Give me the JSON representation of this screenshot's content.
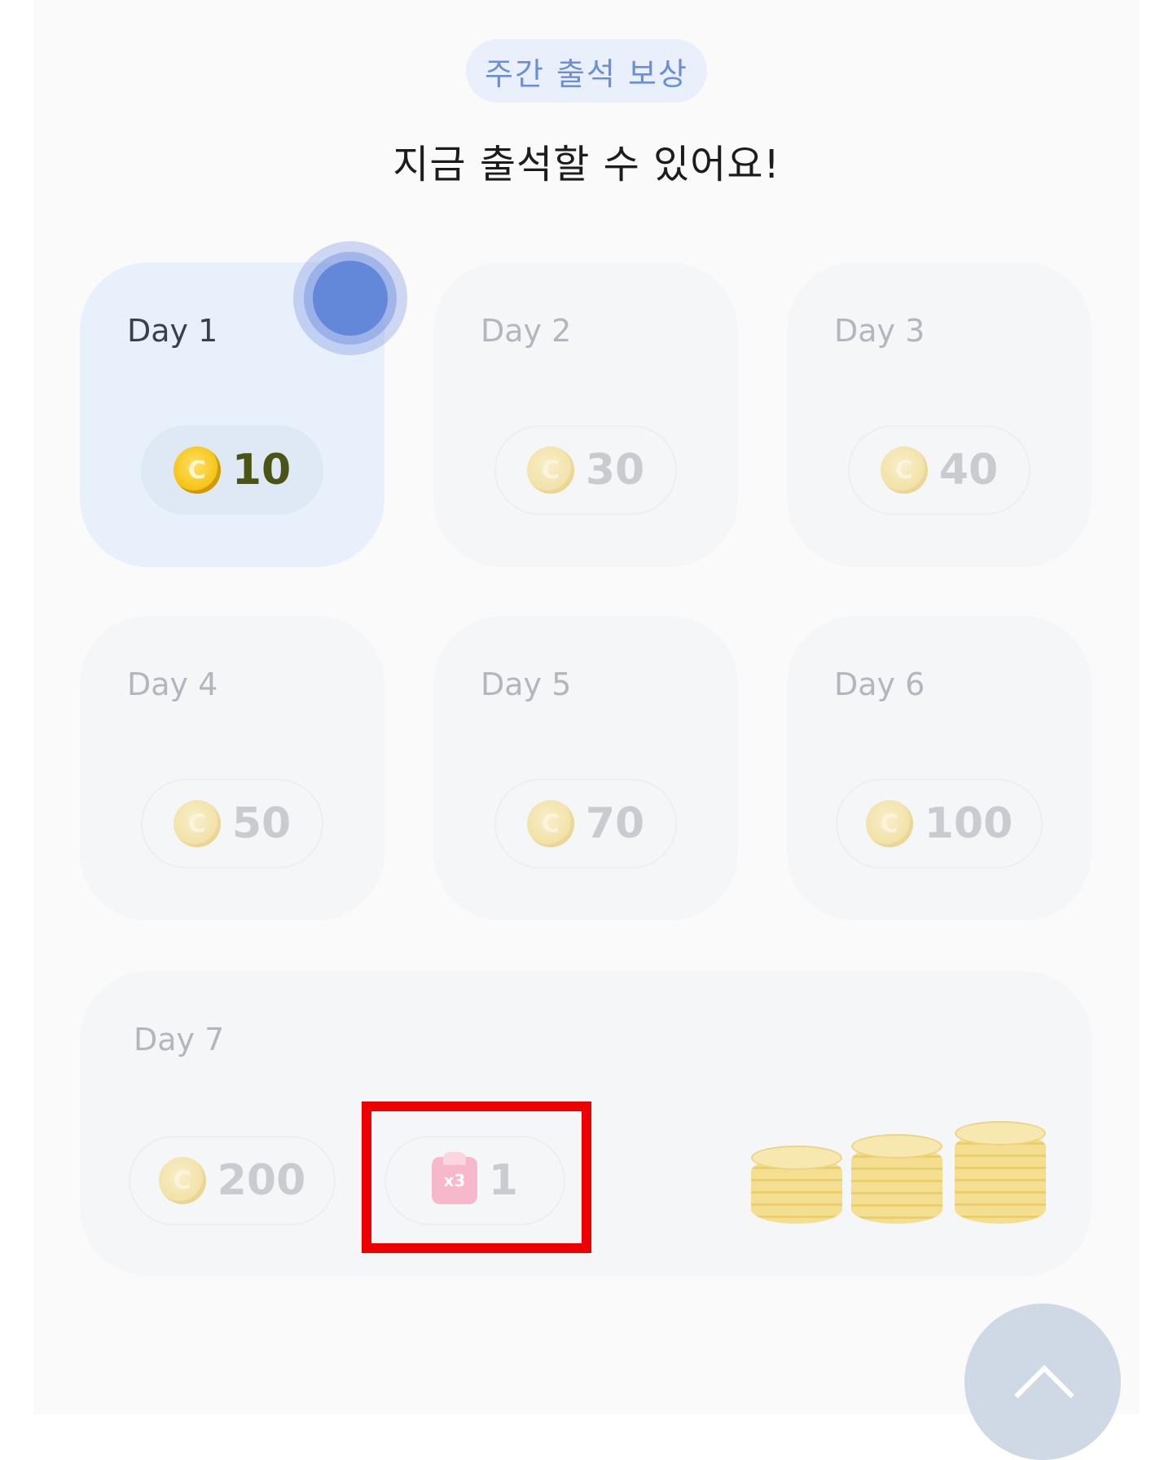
{
  "header": {
    "badge": "주간 출석 보상",
    "headline": "지금 출석할 수 있어요!"
  },
  "days": [
    {
      "label": "Day 1",
      "reward": "10",
      "icon": "coin-icon",
      "active": true
    },
    {
      "label": "Day 2",
      "reward": "30",
      "icon": "coin-icon",
      "active": false
    },
    {
      "label": "Day 3",
      "reward": "40",
      "icon": "coin-icon",
      "active": false
    },
    {
      "label": "Day 4",
      "reward": "50",
      "icon": "coin-icon",
      "active": false
    },
    {
      "label": "Day 5",
      "reward": "70",
      "icon": "coin-icon",
      "active": false
    },
    {
      "label": "Day 6",
      "reward": "100",
      "icon": "coin-icon",
      "active": false
    }
  ],
  "day7": {
    "label": "Day 7",
    "coin_reward": "200",
    "ticket_reward": "1",
    "ticket_badge": "x3",
    "icons": [
      "coin-icon",
      "ticket-icon",
      "coin-stacks-icon"
    ]
  },
  "colors": {
    "accent": "#6387d9",
    "highlight": "#ee0000",
    "badge_bg": "#e9f0fb",
    "badge_text": "#6a8fd6"
  },
  "scroll_top_icon": "chevron-up-icon"
}
